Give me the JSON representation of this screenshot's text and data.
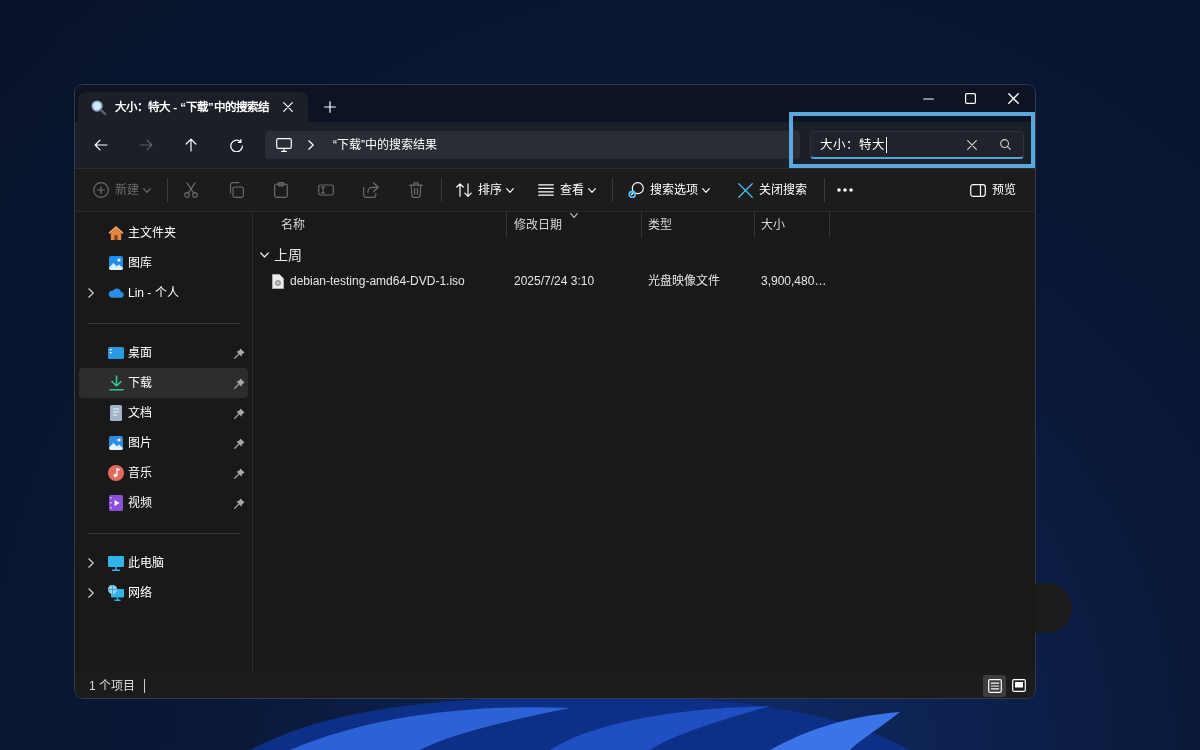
{
  "tabs": [
    {
      "title": "大小：特大 - “下载”中的搜索结",
      "selected": true
    }
  ],
  "nav_buttons": [
    {
      "kind": "back",
      "disabled": false
    },
    {
      "kind": "forward",
      "disabled": true
    },
    {
      "kind": "up",
      "disabled": false
    },
    {
      "kind": "refresh",
      "disabled": false
    }
  ],
  "address_bar": {
    "segments": [
      "“下载”中的搜索结果"
    ]
  },
  "search": {
    "value": "大小：特大",
    "focused": true,
    "highlighted": true
  },
  "toolbar": {
    "groups": [
      [
        {
          "kind": "new",
          "label": "新建",
          "dropdown": true,
          "disabled": true
        }
      ],
      [
        {
          "kind": "cut",
          "dropdown": false,
          "disabled": true
        },
        {
          "kind": "copy",
          "dropdown": false,
          "disabled": true
        },
        {
          "kind": "paste",
          "dropdown": false,
          "disabled": true
        },
        {
          "kind": "rename",
          "dropdown": false,
          "disabled": true
        },
        {
          "kind": "share",
          "dropdown": false,
          "disabled": true
        },
        {
          "kind": "delete",
          "dropdown": false,
          "disabled": true
        }
      ],
      [
        {
          "kind": "sort",
          "label": "排序",
          "dropdown": true,
          "disabled": false
        },
        {
          "kind": "view",
          "label": "查看",
          "dropdown": true,
          "disabled": false
        }
      ],
      [
        {
          "kind": "search_options",
          "label": "搜索选项",
          "dropdown": true,
          "disabled": false
        },
        {
          "kind": "close_search",
          "label": "关闭搜索",
          "dropdown": false,
          "disabled": false
        }
      ],
      [
        {
          "kind": "more",
          "dropdown": false,
          "disabled": false
        }
      ]
    ],
    "preview": {
      "label": "预览",
      "on": false
    }
  },
  "sidebar": {
    "sections": [
      [
        {
          "kind": "home",
          "label": "主文件夹",
          "expandable": false,
          "pinned": false,
          "selected": false
        },
        {
          "kind": "gallery",
          "label": "图库",
          "expandable": false,
          "pinned": false,
          "selected": false
        },
        {
          "kind": "cloud",
          "label": "Lin - 个人",
          "expandable": true,
          "pinned": false,
          "selected": false
        }
      ],
      [
        {
          "kind": "desktop",
          "label": "桌面",
          "expandable": false,
          "pinned": true,
          "selected": false
        },
        {
          "kind": "downloads",
          "label": "下载",
          "expandable": false,
          "pinned": true,
          "selected": true
        },
        {
          "kind": "documents",
          "label": "文档",
          "expandable": false,
          "pinned": true,
          "selected": false
        },
        {
          "kind": "pictures",
          "label": "图片",
          "expandable": false,
          "pinned": true,
          "selected": false
        },
        {
          "kind": "music",
          "label": "音乐",
          "expandable": false,
          "pinned": true,
          "selected": false
        },
        {
          "kind": "videos",
          "label": "视频",
          "expandable": false,
          "pinned": true,
          "selected": false
        }
      ],
      [
        {
          "kind": "pc",
          "label": "此电脑",
          "expandable": true,
          "pinned": false,
          "selected": false
        },
        {
          "kind": "network",
          "label": "网络",
          "expandable": true,
          "pinned": false,
          "selected": false
        }
      ]
    ]
  },
  "file_list": {
    "columns": [
      {
        "label": "名称",
        "sorted": false
      },
      {
        "label": "修改日期",
        "sorted": true
      },
      {
        "label": "类型",
        "sorted": false
      },
      {
        "label": "大小",
        "sorted": false
      }
    ],
    "groups": [
      {
        "label": "上周",
        "expanded": true,
        "rows": [
          {
            "kind": "disc_image",
            "cells": [
              "debian-testing-amd64-DVD-1.iso",
              "2025/7/24 3:10",
              "光盘映像文件",
              "3,900,480…"
            ],
            "selected": false
          }
        ]
      }
    ]
  },
  "status_bar": {
    "item_count": "1 个项目",
    "views": [
      {
        "kind": "details",
        "selected": true
      },
      {
        "kind": "tiles",
        "selected": false
      }
    ]
  }
}
